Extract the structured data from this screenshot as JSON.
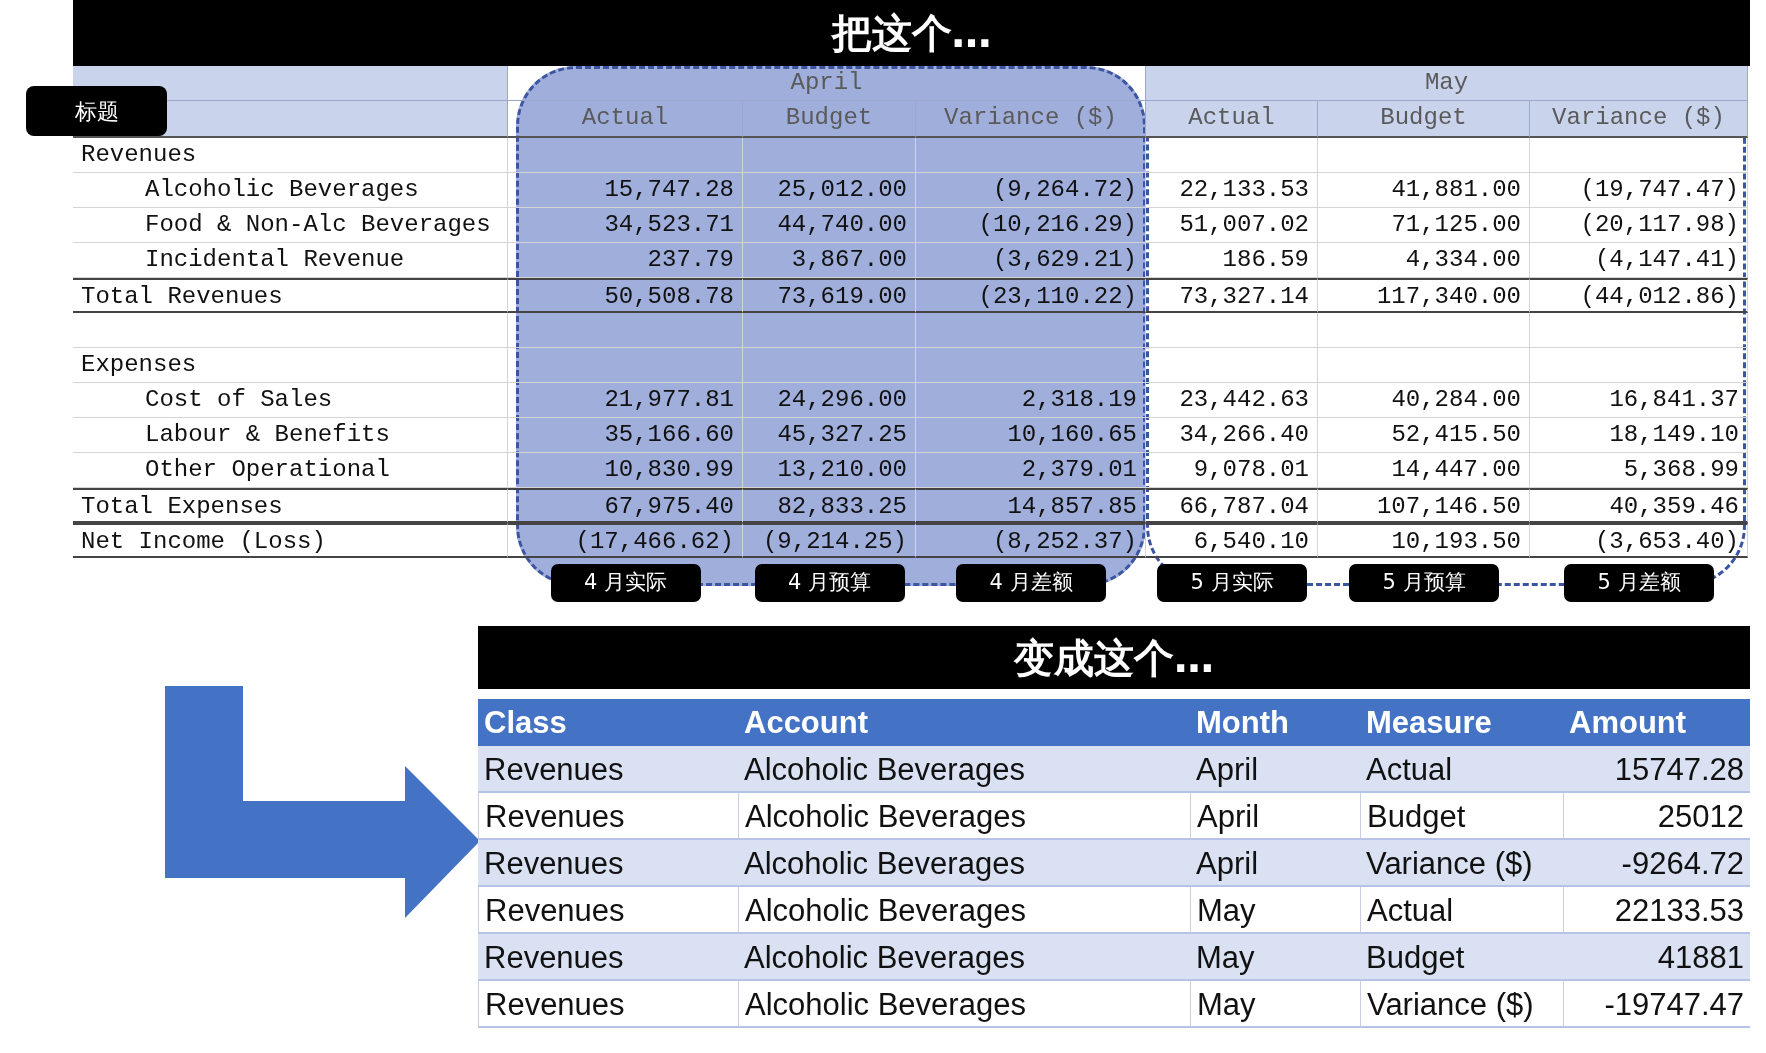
{
  "top_banner": "把这个…",
  "label_tag": "标题",
  "source_table": {
    "groups": [
      {
        "label": "April",
        "highlighted": true,
        "columns": [
          "Actual",
          "Budget",
          "Variance ($)"
        ]
      },
      {
        "label": "May",
        "highlighted": false,
        "columns": [
          "Actual",
          "Budget",
          "Variance ($)"
        ]
      }
    ],
    "rows": [
      {
        "kind": "section",
        "label": "Revenues"
      },
      {
        "kind": "item",
        "label": "Alcoholic Beverages",
        "values": [
          "15,747.28",
          "25,012.00",
          "(9,264.72)",
          "22,133.53",
          "41,881.00",
          "(19,747.47)"
        ]
      },
      {
        "kind": "item",
        "label": "Food & Non-Alc Beverages",
        "values": [
          "34,523.71",
          "44,740.00",
          "(10,216.29)",
          "51,007.02",
          "71,125.00",
          "(20,117.98)"
        ]
      },
      {
        "kind": "item",
        "label": "Incidental Revenue",
        "values": [
          "237.79",
          "3,867.00",
          "(3,629.21)",
          "186.59",
          "4,334.00",
          "(4,147.41)"
        ]
      },
      {
        "kind": "total",
        "label": "Total Revenues",
        "values": [
          "50,508.78",
          "73,619.00",
          "(23,110.22)",
          "73,327.14",
          "117,340.00",
          "(44,012.86)"
        ]
      },
      {
        "kind": "blank"
      },
      {
        "kind": "section",
        "label": "Expenses"
      },
      {
        "kind": "item",
        "label": "Cost of Sales",
        "values": [
          "21,977.81",
          "24,296.00",
          "2,318.19",
          "23,442.63",
          "40,284.00",
          "16,841.37"
        ]
      },
      {
        "kind": "item",
        "label": "Labour & Benefits",
        "values": [
          "35,166.60",
          "45,327.25",
          "10,160.65",
          "34,266.40",
          "52,415.50",
          "18,149.10"
        ]
      },
      {
        "kind": "item",
        "label": "Other Operational",
        "values": [
          "10,830.99",
          "13,210.00",
          "2,379.01",
          "9,078.01",
          "14,447.00",
          "5,368.99"
        ]
      },
      {
        "kind": "total",
        "label": "Total Expenses",
        "values": [
          "67,975.40",
          "82,833.25",
          "14,857.85",
          "66,787.04",
          "107,146.50",
          "40,359.46"
        ]
      },
      {
        "kind": "total",
        "label": "Net Income (Loss)",
        "values": [
          "(17,466.62)",
          "(9,214.25)",
          "(8,252.37)",
          "6,540.10",
          "10,193.50",
          "(3,653.40)"
        ]
      }
    ]
  },
  "column_tags": [
    "4 月实际",
    "4 月预算",
    "4 月差额",
    "5 月实际",
    "5 月预算",
    "5 月差额"
  ],
  "middle_banner": "变成这个…",
  "result_table": {
    "columns": [
      "Class",
      "Account",
      "Month",
      "Measure",
      "Amount"
    ],
    "rows": [
      [
        "Revenues",
        "Alcoholic Beverages",
        "April",
        "Actual",
        "15747.28"
      ],
      [
        "Revenues",
        "Alcoholic Beverages",
        "April",
        "Budget",
        "25012"
      ],
      [
        "Revenues",
        "Alcoholic Beverages",
        "April",
        "Variance ($)",
        "-9264.72"
      ],
      [
        "Revenues",
        "Alcoholic Beverages",
        "May",
        "Actual",
        "22133.53"
      ],
      [
        "Revenues",
        "Alcoholic Beverages",
        "May",
        "Budget",
        "41881"
      ],
      [
        "Revenues",
        "Alcoholic Beverages",
        "May",
        "Variance ($)",
        "-19747.47"
      ]
    ]
  }
}
